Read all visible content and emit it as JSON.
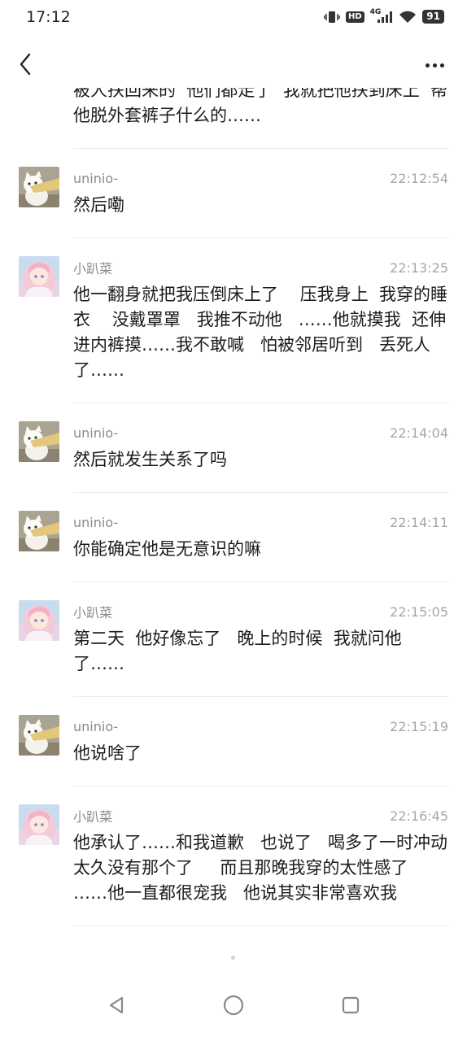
{
  "status": {
    "time": "17:12",
    "hd": "HD",
    "network": "4G",
    "battery": "91"
  },
  "messages": [
    {
      "kind": "partial",
      "sender": "",
      "time": "",
      "text": "被人扶回来的  他们都走了  我就把他扶到床上  帮他脱外套裤子什么的……"
    },
    {
      "kind": "cat",
      "sender": "uninio-",
      "time": "22:12:54",
      "text": "然后嘞"
    },
    {
      "kind": "girl",
      "sender": "小趴菜",
      "time": "22:13:25",
      "text": "他一翻身就把我压倒床上了    压我身上  我穿的睡衣    没戴罩罩   我推不动他   ……他就摸我  还伸进内裤摸……我不敢喊   怕被邻居听到   丢死人了……"
    },
    {
      "kind": "cat",
      "sender": "uninio-",
      "time": "22:14:04",
      "text": "然后就发生关系了吗"
    },
    {
      "kind": "cat",
      "sender": "uninio-",
      "time": "22:14:11",
      "text": "你能确定他是无意识的嘛"
    },
    {
      "kind": "girl",
      "sender": "小趴菜",
      "time": "22:15:05",
      "text": "第二天  他好像忘了   晚上的时候  我就问他了……"
    },
    {
      "kind": "cat",
      "sender": "uninio-",
      "time": "22:15:19",
      "text": "他说啥了"
    },
    {
      "kind": "girl",
      "sender": "小趴菜",
      "time": "22:16:45",
      "text": "他承认了……和我道歉   也说了   喝多了一时冲动    太久没有那个了     而且那晚我穿的太性感了   ……他一直都很宠我   他说其实非常喜欢我"
    }
  ],
  "icons": {
    "back": "chevron-left-icon",
    "more": "more-dots-icon",
    "sys_back": "triangle-back-icon",
    "sys_home": "circle-home-icon",
    "sys_recents": "square-recents-icon"
  }
}
